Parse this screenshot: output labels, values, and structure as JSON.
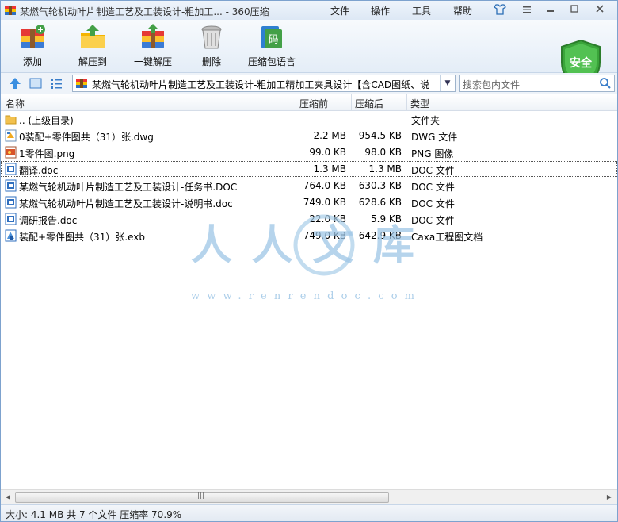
{
  "window": {
    "title": "某燃气轮机动叶片制造工艺及工装设计-粗加工... - 360压缩",
    "menu": [
      "文件",
      "操作",
      "工具",
      "帮助"
    ]
  },
  "toolbar": {
    "buttons": [
      {
        "label": "添加",
        "icon": "add-archive-icon"
      },
      {
        "label": "解压到",
        "icon": "extract-to-icon"
      },
      {
        "label": "一键解压",
        "icon": "one-click-extract-icon"
      },
      {
        "label": "删除",
        "icon": "trash-bin-icon"
      },
      {
        "label": "压缩包语言",
        "icon": "archive-language-icon"
      }
    ],
    "safe_badge": "安全"
  },
  "address": {
    "path": "某燃气轮机动叶片制造工艺及工装设计-粗加工精加工夹具设计【含CAD图纸、说",
    "search_placeholder": "搜索包内文件"
  },
  "columns": {
    "name": "名称",
    "size": "压缩前",
    "packed": "压缩后",
    "type": "类型"
  },
  "files": [
    {
      "name": ".. (上级目录)",
      "size": "",
      "packed": "",
      "type": "文件夹",
      "icon": "folder-icon"
    },
    {
      "name": "0装配+零件图共（31）张.dwg",
      "size": "2.2 MB",
      "packed": "954.5 KB",
      "type": "DWG 文件",
      "icon": "dwg-file-icon"
    },
    {
      "name": "1零件图.png",
      "size": "99.0 KB",
      "packed": "98.0 KB",
      "type": "PNG 图像",
      "icon": "png-file-icon"
    },
    {
      "name": "翻译.doc",
      "size": "1.3 MB",
      "packed": "1.3 MB",
      "type": "DOC 文件",
      "icon": "doc-file-icon"
    },
    {
      "name": "某燃气轮机动叶片制造工艺及工装设计-任务书.DOC",
      "size": "764.0 KB",
      "packed": "630.3 KB",
      "type": "DOC 文件",
      "icon": "doc-file-icon"
    },
    {
      "name": "某燃气轮机动叶片制造工艺及工装设计-说明书.doc",
      "size": "749.0 KB",
      "packed": "628.6 KB",
      "type": "DOC 文件",
      "icon": "doc-file-icon"
    },
    {
      "name": "调研报告.doc",
      "size": "22.0 KB",
      "packed": "5.9 KB",
      "type": "DOC 文件",
      "icon": "doc-file-icon"
    },
    {
      "name": "装配+零件图共（31）张.exb",
      "size": "749.0 KB",
      "packed": "642.9 KB",
      "type": "Caxa工程图文档",
      "icon": "exb-file-icon"
    }
  ],
  "selected_index": 3,
  "watermark": {
    "text": "人人文库",
    "url": "www.renrendoc.com"
  },
  "status": "大小: 4.1 MB 共 7 个文件 压缩率 70.9%"
}
